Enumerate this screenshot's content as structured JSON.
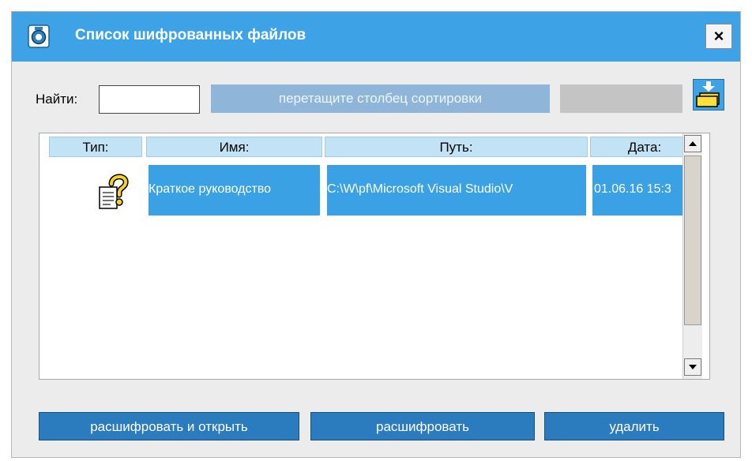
{
  "window": {
    "title": "Список шифрованных файлов",
    "close_label": "×",
    "title_bar_color": "#3ea3e6"
  },
  "toolbar": {
    "find_label": "Найти:",
    "find_value": "",
    "sort_drop_zone_label": "перетащите столбец сортировки",
    "folder_button_icon": "folder-icon"
  },
  "table": {
    "columns": [
      "Тип:",
      "Имя:",
      "Путь:",
      "Дата:"
    ],
    "rows": [
      {
        "type_icon": "help-document-icon",
        "name": "Краткое руководство",
        "path": "C:\\W\\pf\\Microsoft Visual Studio\\V",
        "date": "01.06.16 15:3"
      }
    ],
    "selection_color": "#3aa2e4"
  },
  "actions": {
    "decrypt_and_open": "расшифровать и открыть",
    "decrypt": "расшифровать",
    "delete": "удалить"
  }
}
